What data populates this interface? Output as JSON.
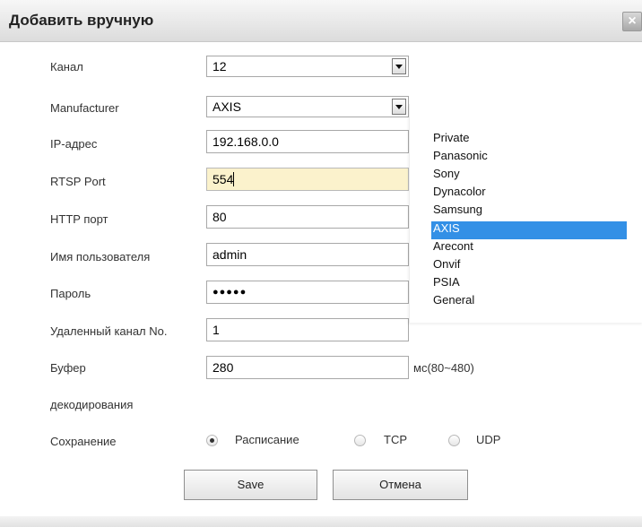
{
  "dialog": {
    "title": "Добавить вручную",
    "close_label": "×"
  },
  "form": {
    "channel": {
      "label": "Канал",
      "value": "12"
    },
    "manufacturer": {
      "label": "Manufacturer",
      "value": "AXIS"
    },
    "ip": {
      "label": "IP-адрес",
      "value": "192.168.0.0"
    },
    "rtsp_port": {
      "label": "RTSP Port",
      "value": "554"
    },
    "http_port": {
      "label": "HTTP порт",
      "value": "80"
    },
    "username": {
      "label": "Имя пользователя",
      "value": "admin"
    },
    "password": {
      "label": "Пароль",
      "value": "●●●●●"
    },
    "remote_channel": {
      "label": "Удаленный канал No.",
      "value": "1"
    },
    "buffer": {
      "label_line1": "Буфер",
      "label_line2": "декодирования",
      "value": "280",
      "unit": "мс(80~480)"
    },
    "save_mode": {
      "label": "Сохранение",
      "options": [
        "Расписание",
        "TCP",
        "UDP"
      ],
      "selected": "Расписание"
    }
  },
  "manufacturer_dropdown": {
    "options": [
      "Private",
      "Panasonic",
      "Sony",
      "Dynacolor",
      "Samsung",
      "AXIS",
      "Arecont",
      "Onvif",
      "PSIA",
      "General"
    ],
    "highlighted": "AXIS"
  },
  "buttons": {
    "save": "Save",
    "cancel": "Отмена"
  },
  "colors": {
    "highlight": "#3390e6",
    "focused_field": "#fbf2cc"
  }
}
